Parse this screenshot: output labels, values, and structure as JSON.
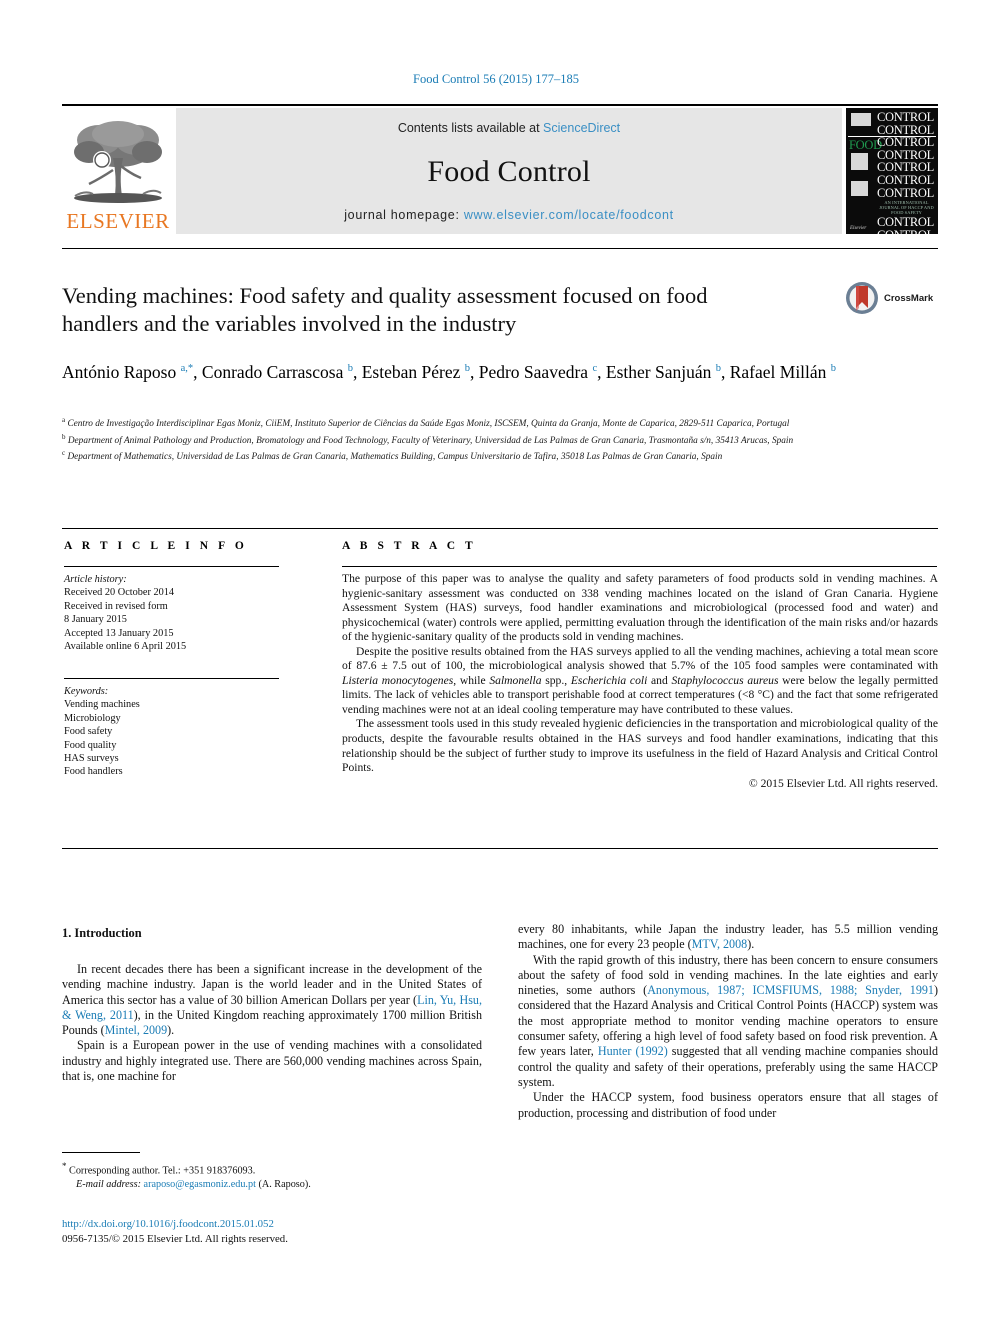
{
  "running_head": "Food Control 56 (2015) 177–185",
  "header": {
    "contents_prefix": "Contents lists available at ",
    "sciencedirect": "ScienceDirect",
    "journal_title": "Food Control",
    "homepage_prefix": "journal homepage: ",
    "homepage_url": "www.elsevier.com/locate/foodcont",
    "publisher_wordmark": "ELSEVIER",
    "cover": {
      "food_word": "FOOD",
      "control_word": "CONTROL",
      "control_repeat": 9,
      "subtitle": "AN INTERNATIONAL JOURNAL OF HACCP AND FOOD SAFETY",
      "imprint": "Elsevier"
    },
    "link_color": "#3a8fc4",
    "band_color": "#e6e6e6",
    "elsevier_orange": "#E87722"
  },
  "crossmark": {
    "label": "CrossMark"
  },
  "article": {
    "title": "Vending machines: Food safety and quality assessment focused on food handlers and the variables involved in the industry",
    "authors_html": "António Raposo <sup>a,*</sup>, Conrado Carrascosa <sup>b</sup>, Esteban Pérez <sup>b</sup>, Pedro Saavedra <sup>c</sup>, Esther Sanjuán <sup>b</sup>, Rafael Millán <sup>b</sup>",
    "affiliations": [
      "Centro de Investigação Interdisciplinar Egas Moniz, CiiEM, Instituto Superior de Ciências da Saúde Egas Moniz, ISCSEM, Quinta da Granja, Monte de Caparica, 2829-511 Caparica, Portugal",
      "Department of Animal Pathology and Production, Bromatology and Food Technology, Faculty of Veterinary, Universidad de Las Palmas de Gran Canaria, Trasmontaña s/n, 35413 Arucas, Spain",
      "Department of Mathematics, Universidad de Las Palmas de Gran Canaria, Mathematics Building, Campus Universitario de Tafira, 35018 Las Palmas de Gran Canaria, Spain"
    ],
    "affiliation_marks": [
      "a",
      "b",
      "c"
    ]
  },
  "info": {
    "heading": "A R T I C L E  I N F O",
    "history_label": "Article history:",
    "history": [
      "Received 20 October 2014",
      "Received in revised form",
      "8 January 2015",
      "Accepted 13 January 2015",
      "Available online 6 April 2015"
    ],
    "keywords_label": "Keywords:",
    "keywords": [
      "Vending machines",
      "Microbiology",
      "Food safety",
      "Food quality",
      "HAS surveys",
      "Food handlers"
    ]
  },
  "abstract": {
    "heading": "A B S T R A C T",
    "paragraph1": "The purpose of this paper was to analyse the quality and safety parameters of food products sold in vending machines. A hygienic-sanitary assessment was conducted on 338 vending machines located on the island of Gran Canaria. Hygiene Assessment System (HAS) surveys, food handler examinations and microbiological (processed food and water) and physicochemical (water) controls were applied, permitting evaluation through the identification of the main risks and/or hazards of the hygienic-sanitary quality of the products sold in vending machines.",
    "paragraph2_a": "Despite the positive results obtained from the HAS surveys applied to all the vending machines, achieving a total mean score of 87.6 ± 7.5 out of 100, the microbiological analysis showed that 5.7% of the 105 food samples were contaminated with ",
    "paragraph2_italic1": "Listeria monocytogenes",
    "paragraph2_b": ", while ",
    "paragraph2_italic2": "Salmonella",
    "paragraph2_c": " spp., ",
    "paragraph2_italic3": "Escherichia coli",
    "paragraph2_d": " and ",
    "paragraph2_italic4": "Staphylococcus aureus",
    "paragraph2_e": " were below the legally permitted limits. The lack of vehicles able to transport perishable food at correct temperatures (<8 °C) and the fact that some refrigerated vending machines were not at an ideal cooling temperature may have contributed to these values.",
    "paragraph3": "The assessment tools used in this study revealed hygienic deficiencies in the transportation and microbiological quality of the products, despite the favourable results obtained in the HAS surveys and food handler examinations, indicating that this relationship should be the subject of further study to improve its usefulness in the field of Hazard Analysis and Critical Control Points.",
    "copyright": "© 2015 Elsevier Ltd. All rights reserved."
  },
  "body": {
    "section_title": "1. Introduction",
    "left": {
      "p1_a": "In recent decades there has been a significant increase in the development of the vending machine industry. Japan is the world leader and in the United States of America this sector has a value of 30 billion American Dollars per year (",
      "p1_ref1": "Lin, Yu, Hsu, & Weng, 2011",
      "p1_b": "), in the United Kingdom reaching approximately 1700 million British Pounds (",
      "p1_ref2": "Mintel, 2009",
      "p1_c": ").",
      "p2": "Spain is a European power in the use of vending machines with a consolidated industry and highly integrated use. There are 560,000 vending machines across Spain, that is, one machine for"
    },
    "right": {
      "p1_a": "every 80 inhabitants, while Japan the industry leader, has 5.5 million vending machines, one for every 23 people (",
      "p1_ref1": "MTV, 2008",
      "p1_b": ").",
      "p2_a": "With the rapid growth of this industry, there has been concern to ensure consumers about the safety of food sold in vending machines. In the late eighties and early nineties, some authors (",
      "p2_ref1": "Anonymous, 1987; ICMSFIUMS, 1988; Snyder, 1991",
      "p2_b": ") considered that the Hazard Analysis and Critical Control Points (HACCP) system was the most appropriate method to monitor vending machine operators to ensure consumer safety, offering a high level of food safety based on food risk prevention. A few years later, ",
      "p2_ref2": "Hunter (1992)",
      "p2_c": " suggested that all vending machine companies should control the quality and safety of their operations, preferably using the same HACCP system.",
      "p3": "Under the HACCP system, food business operators ensure that all stages of production, processing and distribution of food under"
    }
  },
  "footer": {
    "corresponding_marker": "*",
    "corresponding": "Corresponding author. Tel.: +351 918376093.",
    "email_label": "E-mail address:",
    "email": "araposo@egasmoniz.edu.pt",
    "email_owner": "(A. Raposo).",
    "doi": "http://dx.doi.org/10.1016/j.foodcont.2015.01.052",
    "issn_line": "0956-7135/© 2015 Elsevier Ltd. All rights reserved."
  }
}
